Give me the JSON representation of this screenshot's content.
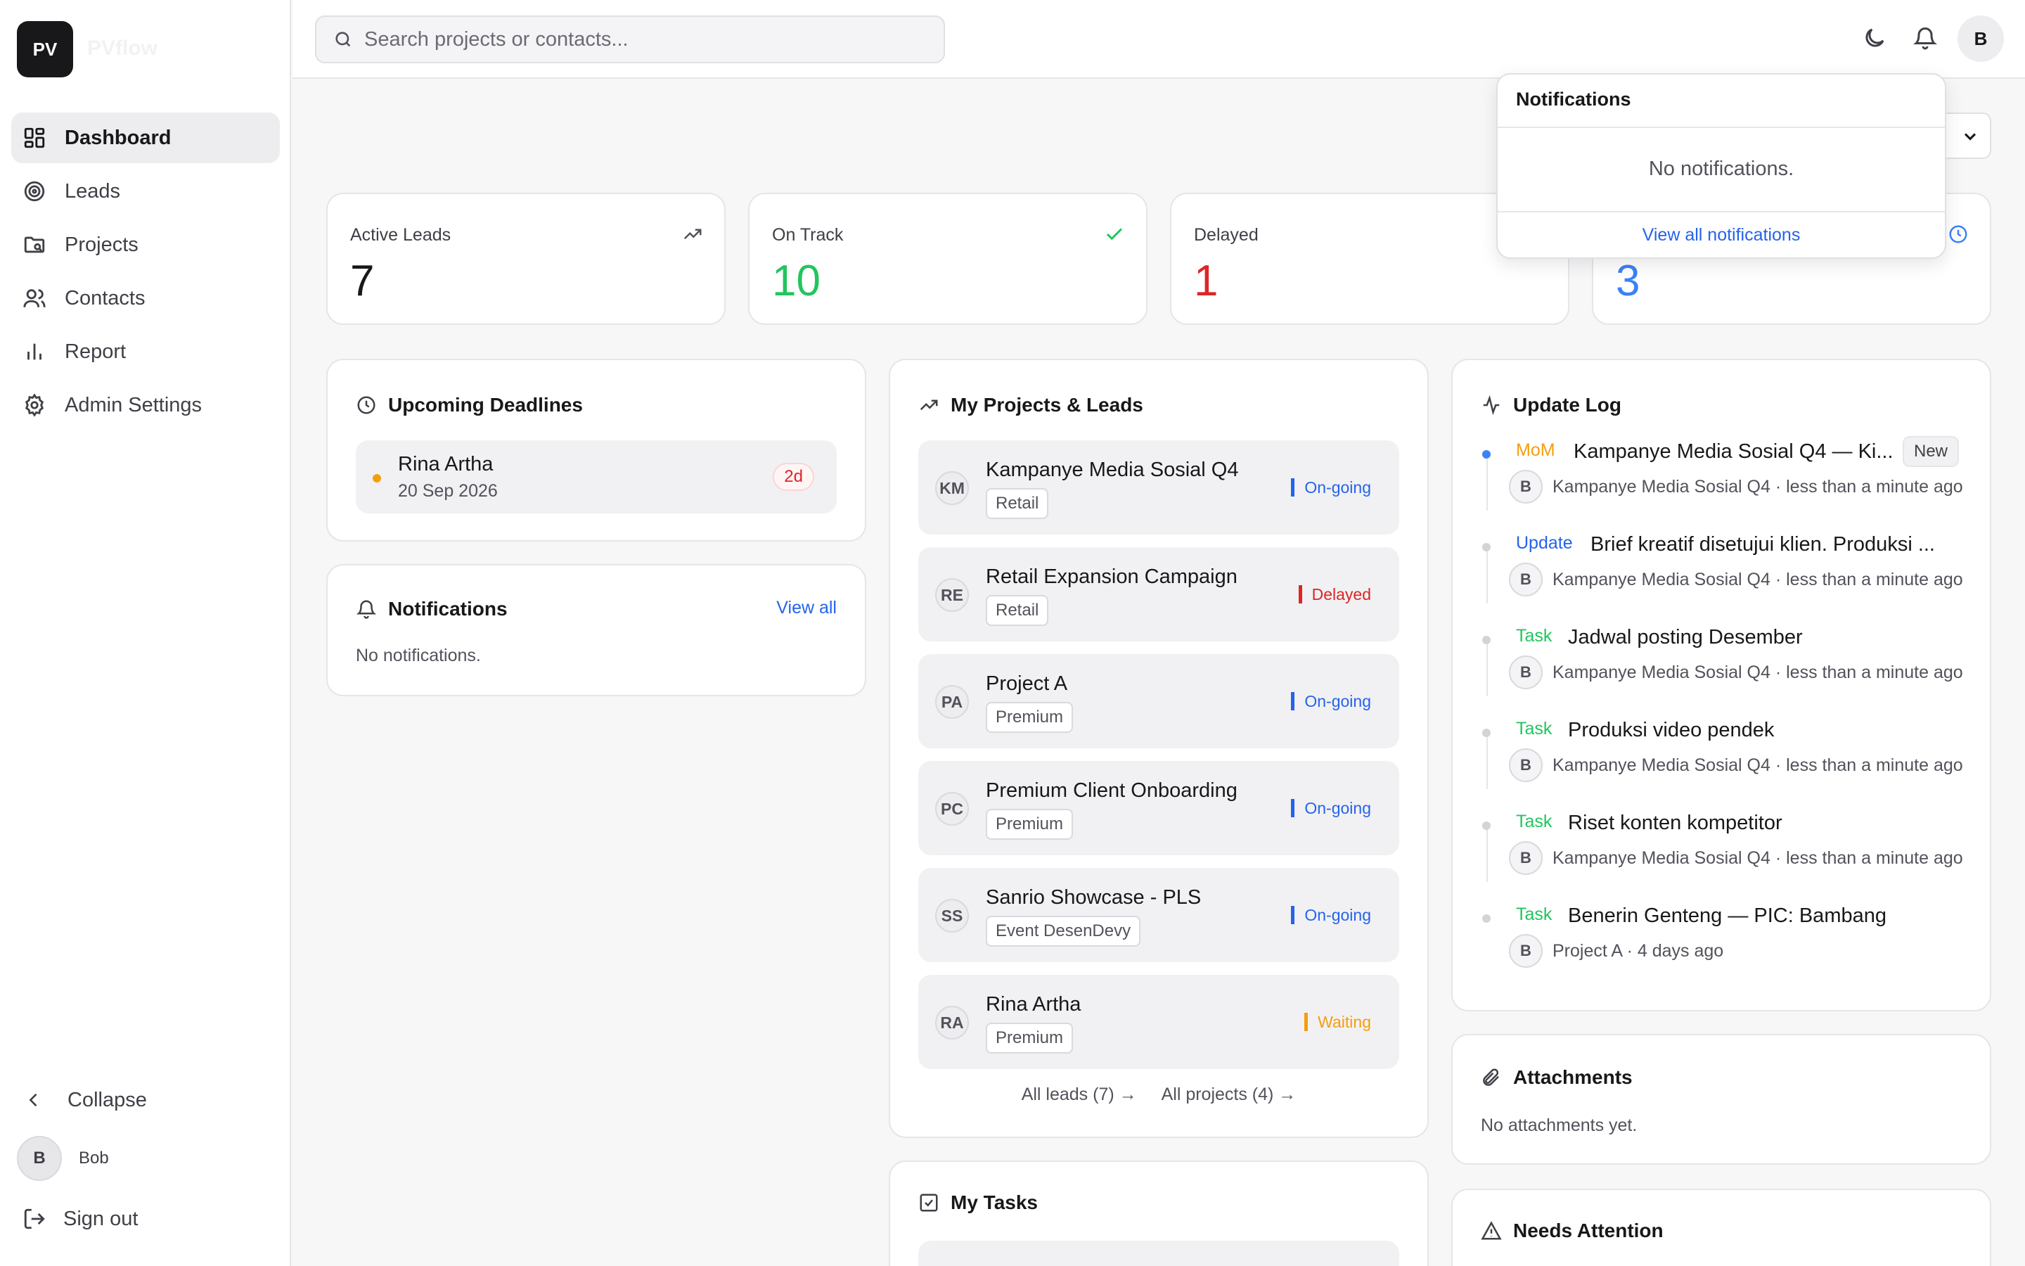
{
  "app": {
    "logo_initials": "PV",
    "logo_name": "PVflow"
  },
  "sidebar": {
    "items": [
      {
        "label": "Dashboard",
        "icon": "dashboard-icon",
        "active": true
      },
      {
        "label": "Leads",
        "icon": "target-icon"
      },
      {
        "label": "Projects",
        "icon": "folder-icon"
      },
      {
        "label": "Contacts",
        "icon": "users-icon"
      },
      {
        "label": "Report",
        "icon": "bar-chart-icon"
      },
      {
        "label": "Admin Settings",
        "icon": "gear-icon"
      }
    ],
    "collapse_label": "Collapse",
    "user": {
      "initial": "B",
      "name": "Bob"
    },
    "signout_label": "Sign out"
  },
  "topbar": {
    "search_placeholder": "Search projects or contacts...",
    "avatar_initial": "B"
  },
  "stats": [
    {
      "label": "Active Leads",
      "value": "7",
      "color": "#18181b",
      "icon": "trending-up-icon"
    },
    {
      "label": "On Track",
      "value": "10",
      "color": "#22c55e",
      "icon": "check-icon"
    },
    {
      "label": "Delayed",
      "value": "1",
      "color": "#dc2626",
      "icon": "alert-icon"
    },
    {
      "label": "",
      "value": "3",
      "color": "#3b82f6",
      "icon": "clock-icon"
    }
  ],
  "deadlines": {
    "title": "Upcoming Deadlines",
    "items": [
      {
        "name": "Rina Artha",
        "date": "20 Sep 2026",
        "badge": "2d"
      }
    ]
  },
  "notifications_card": {
    "title": "Notifications",
    "view_all": "View all",
    "empty": "No notifications."
  },
  "projects": {
    "title": "My Projects & Leads",
    "items": [
      {
        "initials": "KM",
        "name": "Kampanye Media Sosial Q4",
        "tag": "Retail",
        "status": "On-going",
        "status_color": "#2563eb"
      },
      {
        "initials": "RE",
        "name": "Retail Expansion Campaign",
        "tag": "Retail",
        "status": "Delayed",
        "status_color": "#dc2626"
      },
      {
        "initials": "PA",
        "name": "Project A",
        "tag": "Premium",
        "status": "On-going",
        "status_color": "#2563eb"
      },
      {
        "initials": "PC",
        "name": "Premium Client Onboarding",
        "tag": "Premium",
        "status": "On-going",
        "status_color": "#2563eb"
      },
      {
        "initials": "SS",
        "name": "Sanrio Showcase - PLS",
        "tag": "Event DesenDevy",
        "status": "On-going",
        "status_color": "#2563eb"
      },
      {
        "initials": "RA",
        "name": "Rina Artha",
        "tag": "Premium",
        "status": "Waiting",
        "status_color": "#f59e0b"
      }
    ],
    "all_leads": "All leads (7) →",
    "all_projects": "All projects (4) →"
  },
  "tasks": {
    "title": "My Tasks"
  },
  "update_log": {
    "title": "Update Log",
    "items": [
      {
        "type": "MoM",
        "type_color": "#f59e0b",
        "text": "Kampanye Media Sosial Q4 — Ki...",
        "badge": "New",
        "avatar": "B",
        "meta": "Kampanye Media Sosial Q4 · less than a minute ago",
        "dot": "#3b82f6"
      },
      {
        "type": "Update",
        "type_color": "#2563eb",
        "text": "Brief kreatif disetujui klien. Produksi ...",
        "avatar": "B",
        "meta": "Kampanye Media Sosial Q4 · less than a minute ago",
        "dot": "#d4d4d8"
      },
      {
        "type": "Task",
        "type_color": "#22c55e",
        "text": "Jadwal posting Desember",
        "avatar": "B",
        "meta": "Kampanye Media Sosial Q4 · less than a minute ago",
        "dot": "#d4d4d8"
      },
      {
        "type": "Task",
        "type_color": "#22c55e",
        "text": "Produksi video pendek",
        "avatar": "B",
        "meta": "Kampanye Media Sosial Q4 · less than a minute ago",
        "dot": "#d4d4d8"
      },
      {
        "type": "Task",
        "type_color": "#22c55e",
        "text": "Riset konten kompetitor",
        "avatar": "B",
        "meta": "Kampanye Media Sosial Q4 · less than a minute ago",
        "dot": "#d4d4d8"
      },
      {
        "type": "Task",
        "type_color": "#22c55e",
        "text": "Benerin Genteng — PIC: Bambang",
        "avatar": "B",
        "meta": "Project A · 4 days ago",
        "dot": "#d4d4d8"
      }
    ]
  },
  "attachments": {
    "title": "Attachments",
    "empty": "No attachments yet."
  },
  "needs_attention": {
    "title": "Needs Attention"
  },
  "notif_popover": {
    "title": "Notifications",
    "empty": "No notifications.",
    "view_all": "View all notifications"
  }
}
